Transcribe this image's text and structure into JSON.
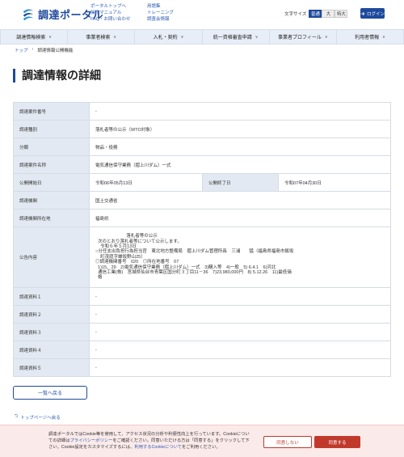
{
  "header": {
    "logo_text": "調達ポータル",
    "links_col1": [
      "ポータルトップへ",
      "操作マニュアル",
      "FAQ・お問い合わせ"
    ],
    "links_col2": [
      "用語集",
      "トレーニング",
      "調査会情報"
    ],
    "font_size_label": "文字サイズ",
    "font_sizes": [
      "普通",
      "大",
      "特大"
    ],
    "login_label": "ログイン"
  },
  "nav": {
    "items": [
      "調達情報検索",
      "事業者検索",
      "入札・契約",
      "統一資格審査申請",
      "事業者プロフィール",
      "利用者情報"
    ]
  },
  "breadcrumb": {
    "home": "トップ",
    "current": "調達情報公開機能"
  },
  "page": {
    "title": "調達情報の詳細"
  },
  "details": {
    "case_no_label": "調達案件番号",
    "case_no_value": "-",
    "type_label": "調達種別",
    "type_value": "落札者等の公示（WTO対象）",
    "category_label": "分類",
    "category_value": "物品・役務",
    "name_label": "調達案件名称",
    "name_value": "電気通信保守業務（摺上川ダム）一式",
    "start_label": "公開開始日",
    "start_value": "令和06年05月13日",
    "end_label": "公開終了日",
    "end_value": "令和07年04月30日",
    "org_label": "調達機関",
    "org_value": "国土交通省",
    "location_label": "調達機関所在地",
    "location_value": "福島県",
    "notice_label": "公告内容",
    "notice_value": "                         落札者等の公示\n  次のとおり落札者等について公示します。\n    令和６年５月13日\n○分任支出負担行為担当官　東北地方整備局　摺上川ダム管理所長　三浦　　猛（福島県福島市飯坂\n    町茂庭字蝉坂野山25）\n◎調達機関番号　020　◎所在地番号　07\n  1)15、29　2)電気通信保守業務（摺上川ダム）一式　3)購入等　4)一般　5) 6.4.1　6)河北\n  通信工業(株)　宮城県仙台市青葉区国分町３丁目11－36　7)23,980,000円　8) 5.12.26　11)最低価\n  格",
    "doc1_label": "調達資料１",
    "doc1_value": "-",
    "doc2_label": "調達資料２",
    "doc2_value": "-",
    "doc3_label": "調達資料３",
    "doc3_value": "-",
    "doc4_label": "調達資料４",
    "doc4_value": "-",
    "doc5_label": "調達資料５",
    "doc5_value": "-"
  },
  "actions": {
    "back_label": "一覧へ戻る",
    "top_label": "トップページへ戻る"
  },
  "cookie": {
    "text_1": "調達ポータルではCookie等を使用して、アクセス状況の分析や利便性向上を行っています。Cookieについての詳細は",
    "policy_link": "プライバシーポリシー",
    "text_2": "をご確認ください。同意いただける方は「同意する」をクリックして下さい。Cookie設定をカスタマイズするには、",
    "settings_link": "利用するCookieについて",
    "text_3": "をご利用ください。",
    "deny_label": "同意しない",
    "accept_label": "同意する"
  },
  "colors": {
    "brand": "#1e4a9c",
    "accent": "#c0392b",
    "table_header_bg": "#e3e9f2"
  }
}
